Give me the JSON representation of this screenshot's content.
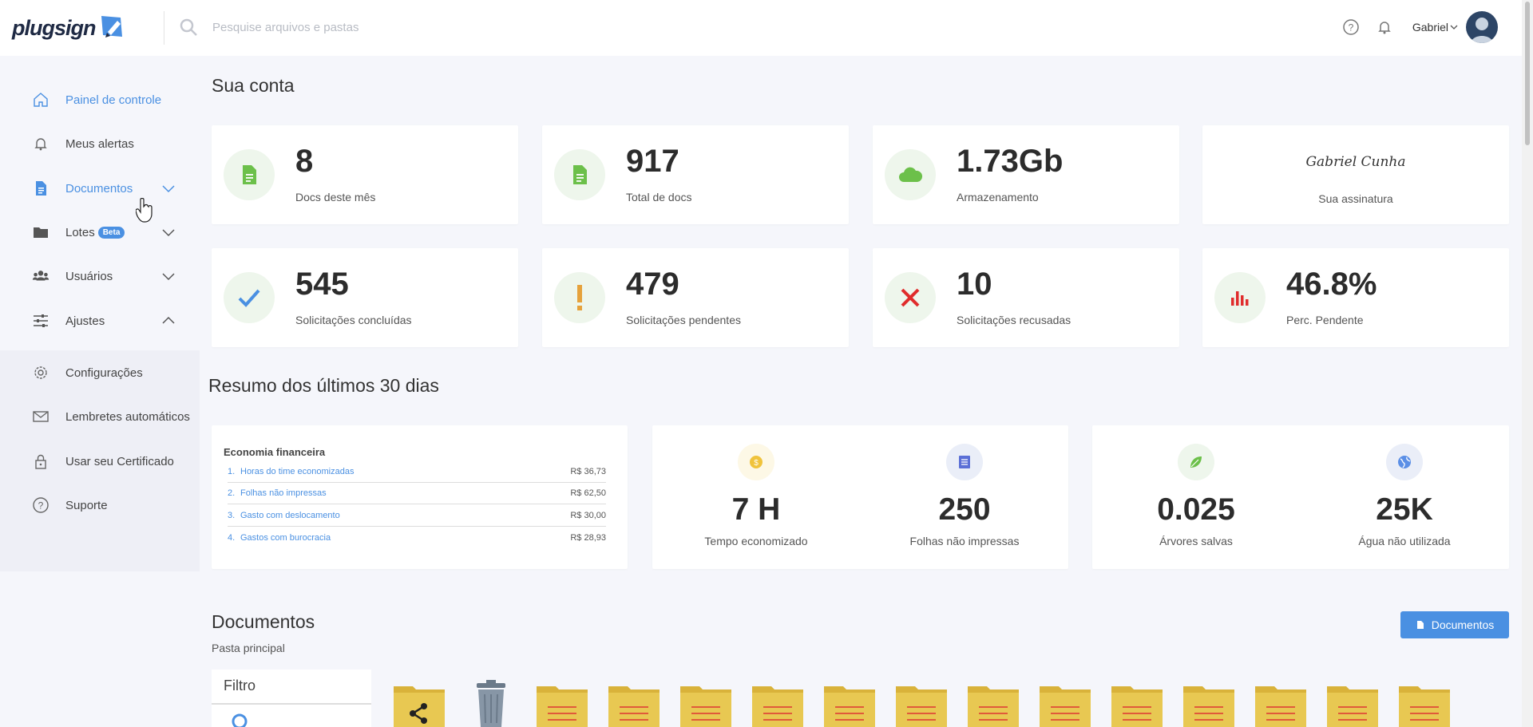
{
  "header": {
    "logo_text": "plugsign",
    "search_placeholder": "Pesquise arquivos e pastas",
    "username": "Gabriel"
  },
  "sidebar": {
    "items": [
      {
        "label": "Painel de controle",
        "icon": "home-icon",
        "active": true
      },
      {
        "label": "Meus alertas",
        "icon": "bell-icon"
      },
      {
        "label": "Documentos",
        "icon": "document-icon",
        "expand": "down"
      },
      {
        "label": "Lotes",
        "icon": "folder-icon",
        "badge": "Beta",
        "expand": "down"
      },
      {
        "label": "Usuários",
        "icon": "users-icon",
        "expand": "down"
      },
      {
        "label": "Ajustes",
        "icon": "sliders-icon",
        "expand": "up"
      }
    ],
    "subitems": [
      {
        "label": "Configurações",
        "icon": "gear-icon"
      },
      {
        "label": "Lembretes automáticos",
        "icon": "envelope-icon"
      },
      {
        "label": "Usar seu Certificado",
        "icon": "lock-icon"
      },
      {
        "label": "Suporte",
        "icon": "help-icon"
      }
    ]
  },
  "account": {
    "title": "Sua conta",
    "stats": [
      {
        "value": "8",
        "label": "Docs deste mês",
        "icon": "document-icon",
        "color": "#6cc04a"
      },
      {
        "value": "917",
        "label": "Total de docs",
        "icon": "document-icon",
        "color": "#6cc04a"
      },
      {
        "value": "1.73Gb",
        "label": "Armazenamento",
        "icon": "cloud-icon",
        "color": "#6cc04a"
      },
      {
        "value": "545",
        "label": "Solicitações concluídas",
        "icon": "check-icon",
        "color": "#4a90e2"
      },
      {
        "value": "479",
        "label": "Solicitações pendentes",
        "icon": "exclamation-icon",
        "color": "#e6a23c"
      },
      {
        "value": "10",
        "label": "Solicitações recusadas",
        "icon": "x-icon",
        "color": "#e02c2c"
      },
      {
        "value": "46.8%",
        "label": "Perc. Pendente",
        "icon": "bar-chart-icon",
        "color": "#e02c2c"
      }
    ],
    "signature": {
      "name": "Gabriel Cunha",
      "label": "Sua assinatura"
    }
  },
  "summary": {
    "title": "Resumo dos últimos 30 dias",
    "economy_title": "Economia financeira",
    "economy_rows": [
      {
        "n": "1.",
        "label": "Horas do time economizadas",
        "value": "R$ 36,73"
      },
      {
        "n": "2.",
        "label": "Folhas não impressas",
        "value": "R$ 62,50"
      },
      {
        "n": "3.",
        "label": "Gasto com deslocamento",
        "value": "R$ 30,00"
      },
      {
        "n": "4.",
        "label": "Gastos com burocracia",
        "value": "R$ 28,93"
      }
    ],
    "metrics": [
      {
        "value": "7 H",
        "label": "Tempo economizado",
        "icon": "coin-icon"
      },
      {
        "value": "250",
        "label": "Folhas não impressas",
        "icon": "notebook-icon"
      },
      {
        "value": "0.025",
        "label": "Árvores salvas",
        "icon": "leaf-icon"
      },
      {
        "value": "25K",
        "label": "Água não utilizada",
        "icon": "globe-icon"
      }
    ]
  },
  "documents": {
    "title": "Documentos",
    "path": "Pasta principal",
    "button": "Documentos",
    "filter_title": "Filtro",
    "folders": [
      "shared-folder-icon",
      "trash-icon",
      "folder-icon",
      "folder-icon",
      "folder-icon",
      "folder-icon",
      "folder-icon",
      "folder-icon",
      "folder-icon",
      "folder-icon",
      "folder-icon",
      "folder-icon",
      "folder-icon",
      "folder-icon",
      "folder-icon"
    ]
  }
}
